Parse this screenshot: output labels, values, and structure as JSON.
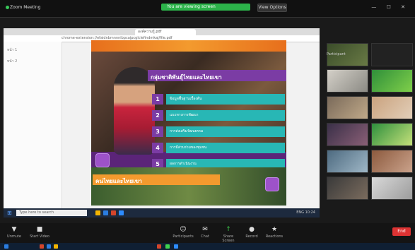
{
  "top_bar": {
    "app_title": "Zoom Meeting",
    "green_banner": "You are viewing screen",
    "view_options": "View Options"
  },
  "browser": {
    "tab_title": "องค์ความรู้.pdf",
    "address": "chrome-extension://efaidnbmnnnibpcajpcglclefindmkaj/file.pdf"
  },
  "left_pane": {
    "items": [
      "หน้า 1",
      "หน้า 2"
    ]
  },
  "slide": {
    "title": "กลุ่มชาติพันธุ์ไทยและไทยเขา",
    "rows": [
      {
        "num": "1",
        "text": "ข้อมูลพื้นฐานเบื้องต้น"
      },
      {
        "num": "2",
        "text": "แนวทางการพัฒนา"
      },
      {
        "num": "3",
        "text": "การส่งเสริมวัฒนธรรม"
      },
      {
        "num": "4",
        "text": "การมีส่วนร่วมของชุมชน"
      },
      {
        "num": "5",
        "text": "ผลการดำเนินงาน"
      }
    ],
    "bottom_title": "คนไทยและไทยเขา"
  },
  "ppt_taskbar": {
    "search_placeholder": "Type here to search",
    "right_text": "ENG 10:24"
  },
  "gallery": {
    "label": "Participant"
  },
  "controls": [
    {
      "icon": "▼",
      "label": "Unmute"
    },
    {
      "icon": "■",
      "label": "Start Video"
    },
    {
      "icon": "☺",
      "label": "Participants"
    },
    {
      "icon": "✉",
      "label": "Chat"
    },
    {
      "icon": "↑",
      "label": "Share Screen"
    },
    {
      "icon": "●",
      "label": "Record"
    },
    {
      "icon": "★",
      "label": "Reactions"
    }
  ],
  "end_button": "End",
  "colors": {
    "slide_purple": "#5b2479",
    "slide_teal": "#28b7b5",
    "slide_orange": "#f39a2e",
    "zoom_green": "#2cb34a",
    "end_red": "#dd3333"
  }
}
